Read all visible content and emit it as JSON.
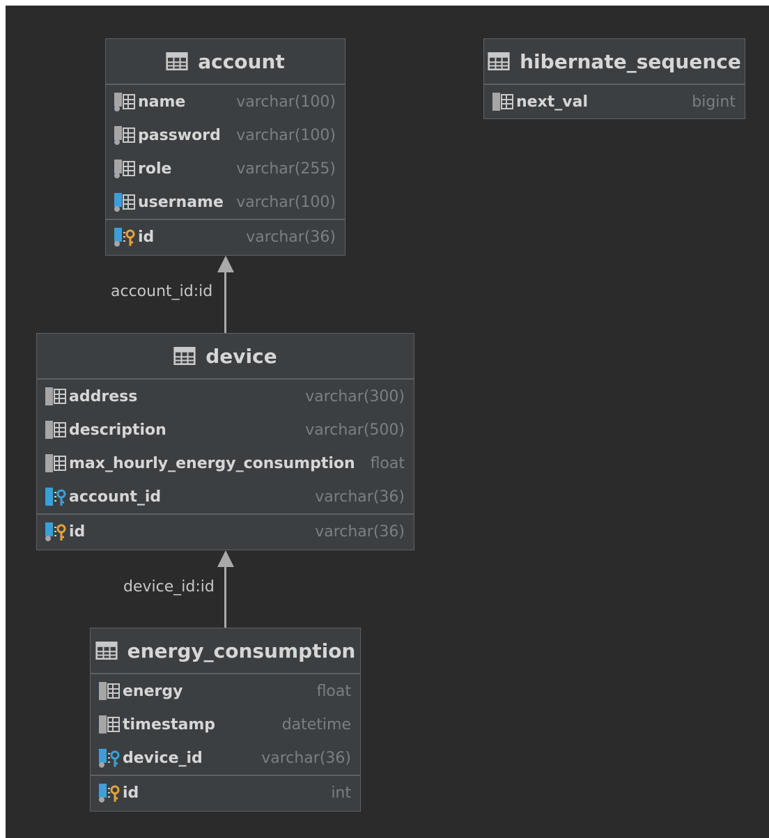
{
  "tables": {
    "account": {
      "title": "account",
      "columns": [
        {
          "name": "name",
          "type": "varchar(100)"
        },
        {
          "name": "password",
          "type": "varchar(100)"
        },
        {
          "name": "role",
          "type": "varchar(255)"
        },
        {
          "name": "username",
          "type": "varchar(100)"
        }
      ],
      "pk": {
        "name": "id",
        "type": "varchar(36)"
      }
    },
    "hibernate_sequence": {
      "title": "hibernate_sequence",
      "columns": [
        {
          "name": "next_val",
          "type": "bigint"
        }
      ]
    },
    "device": {
      "title": "device",
      "columns": [
        {
          "name": "address",
          "type": "varchar(300)"
        },
        {
          "name": "description",
          "type": "varchar(500)"
        },
        {
          "name": "max_hourly_energy_consumption",
          "type": "float"
        },
        {
          "name": "account_id",
          "type": "varchar(36)"
        }
      ],
      "pk": {
        "name": "id",
        "type": "varchar(36)"
      }
    },
    "energy_consumption": {
      "title": "energy_consumption",
      "columns": [
        {
          "name": "energy",
          "type": "float"
        },
        {
          "name": "timestamp",
          "type": "datetime"
        },
        {
          "name": "device_id",
          "type": "varchar(36)"
        }
      ],
      "pk": {
        "name": "id",
        "type": "int"
      }
    }
  },
  "relations": [
    {
      "label": "account_id:id"
    },
    {
      "label": "device_id:id"
    }
  ],
  "colors": {
    "background": "#2b2b2b",
    "table_bg": "#3c3f41",
    "border": "#5e6164",
    "text": "#d6d6d6",
    "type_text": "#7c7f82",
    "fk_key": "#3c9fd8",
    "pk_key": "#e3a33b",
    "arrow": "#a9a9a9"
  }
}
